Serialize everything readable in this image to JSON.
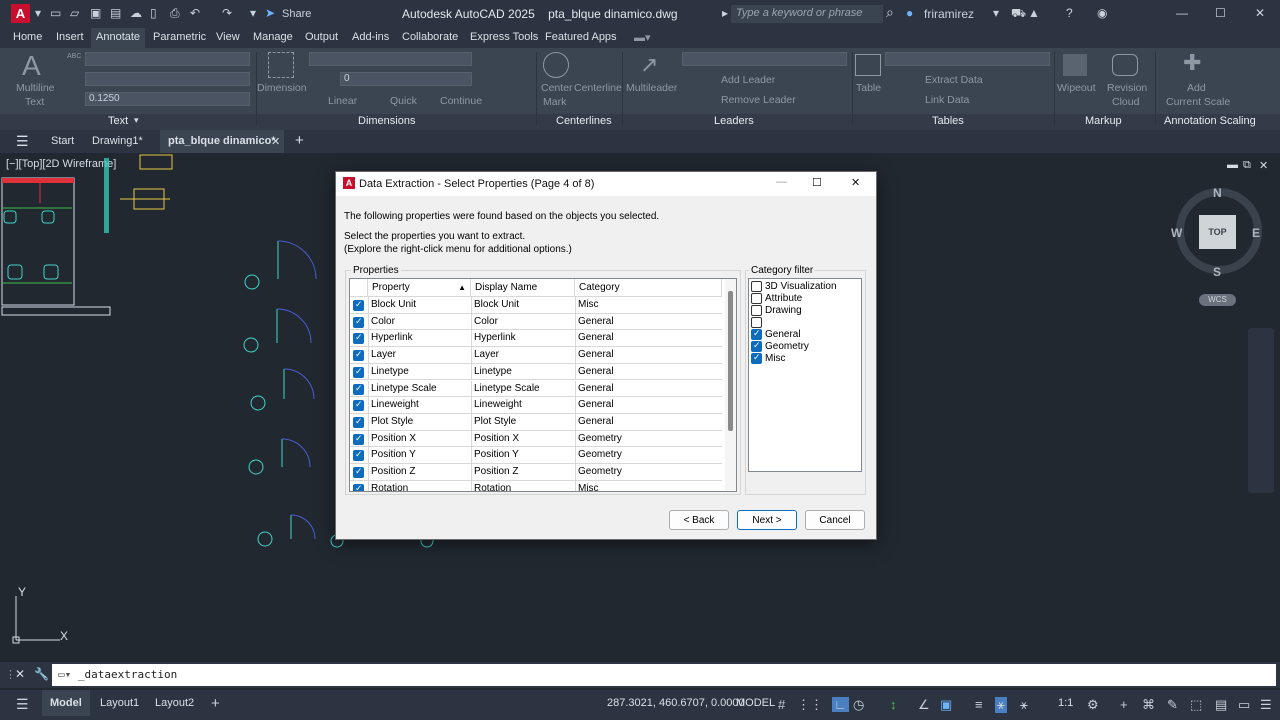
{
  "app": {
    "title": "Autodesk AutoCAD 2025",
    "file": "pta_blque dinamico.dwg",
    "logo": "A",
    "share_label": "Share",
    "search_placeholder": "Type a keyword or phrase",
    "user": "friramirez"
  },
  "menu_tabs": [
    "Home",
    "Insert",
    "Annotate",
    "Parametric",
    "View",
    "Manage",
    "Output",
    "Add-ins",
    "Collaborate",
    "Express Tools",
    "Featured Apps"
  ],
  "ribbon": {
    "text": {
      "big_label1": "Multiline",
      "big_label2": "Text",
      "height_value": "0.1250",
      "abc": "ABC",
      "panel": "Text"
    },
    "dimensions": {
      "big_label": "Dimension",
      "layer_value": "0",
      "linear": "Linear",
      "quick": "Quick",
      "continue": "Continue",
      "panel": "Dimensions"
    },
    "centerlines": {
      "center_mark1": "Center",
      "center_mark2": "Mark",
      "centerline": "Centerline",
      "panel": "Centerlines"
    },
    "leaders": {
      "multileader": "Multileader",
      "add_leader": "Add Leader",
      "remove_leader": "Remove Leader",
      "panel": "Leaders"
    },
    "tables": {
      "table": "Table",
      "extract_data": "Extract Data",
      "link_data": "Link Data",
      "panel": "Tables"
    },
    "markup": {
      "wipeout": "Wipeout",
      "revision_cloud1": "Revision",
      "revision_cloud2": "Cloud",
      "panel": "Markup"
    },
    "annotation_scaling": {
      "add_scale1": "Add",
      "add_scale2": "Current Scale",
      "panel": "Annotation Scaling"
    }
  },
  "doc_tabs": [
    "Start",
    "Drawing1*",
    "pta_blque dinamico*"
  ],
  "viewport_label": "[−][Top][2D Wireframe]",
  "viewcube": {
    "top": "TOP",
    "n": "N",
    "s": "S",
    "e": "E",
    "w": "W",
    "wcs": "WCS"
  },
  "ucs": {
    "x": "X",
    "y": "Y"
  },
  "dialog": {
    "title": "Data Extraction - Select Properties (Page 4 of 8)",
    "intro": "The following properties were found based on the objects you selected.",
    "instruction1": "Select the properties you want to extract.",
    "instruction2": "(Explore the right-click menu for additional options.)",
    "properties_group": "Properties",
    "category_group": "Category filter",
    "columns": [
      "Property",
      "Display Name",
      "Category"
    ],
    "rows": [
      [
        "Block Unit",
        "Block Unit",
        "Misc"
      ],
      [
        "Color",
        "Color",
        "General"
      ],
      [
        "Hyperlink",
        "Hyperlink",
        "General"
      ],
      [
        "Layer",
        "Layer",
        "General"
      ],
      [
        "Linetype",
        "Linetype",
        "General"
      ],
      [
        "Linetype Scale",
        "Linetype Scale",
        "General"
      ],
      [
        "Lineweight",
        "Lineweight",
        "General"
      ],
      [
        "Plot Style",
        "Plot Style",
        "General"
      ],
      [
        "Position X",
        "Position X",
        "Geometry"
      ],
      [
        "Position Y",
        "Position Y",
        "Geometry"
      ],
      [
        "Position Z",
        "Position Z",
        "Geometry"
      ],
      [
        "Rotation",
        "Rotation",
        "Misc"
      ]
    ],
    "categories": [
      {
        "label": "3D Visualization",
        "checked": false
      },
      {
        "label": "Attribute",
        "checked": false
      },
      {
        "label": "Drawing",
        "checked": false
      },
      {
        "label": "",
        "checked": false
      },
      {
        "label": "General",
        "checked": true
      },
      {
        "label": "Geometry",
        "checked": true
      },
      {
        "label": "Misc",
        "checked": true
      }
    ],
    "back_label": "< Back",
    "next_label": "Next >",
    "cancel_label": "Cancel"
  },
  "command_line": {
    "value": "_dataextraction"
  },
  "status": {
    "tabs": [
      "Model",
      "Layout1",
      "Layout2"
    ],
    "coords": "287.3021, 460.6707, 0.0000",
    "mode": "MODEL",
    "scale": "1:1"
  },
  "colors": {
    "accent": "#0f6cbd",
    "cyan": "#3fd6c8",
    "yellow": "#e6c84a",
    "green": "#3fbf4a",
    "red": "#e0303a"
  }
}
